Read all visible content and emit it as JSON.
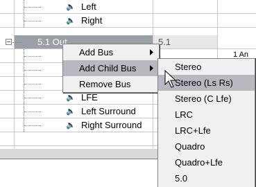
{
  "tree": {
    "expander_symbol": "−",
    "rows": [
      {
        "label": "Left",
        "icon": "speaker-icon"
      },
      {
        "label": "Right",
        "icon": "speaker-icon"
      },
      {
        "label": "5.1 Out",
        "config": "5.1"
      },
      {
        "label": "LFE",
        "icon": "speaker-icon"
      },
      {
        "label": "Left Surround",
        "icon": "speaker-icon"
      },
      {
        "label": "Right Surround",
        "icon": "speaker-icon"
      }
    ],
    "partial_right_text": "1 An"
  },
  "context_menu": {
    "items": [
      {
        "label": "Add Bus",
        "has_submenu": true
      },
      {
        "label": "Add Child Bus",
        "has_submenu": true,
        "selected": true
      },
      {
        "label": "Remove Bus",
        "has_submenu": false
      }
    ]
  },
  "submenu": {
    "items": [
      {
        "label": "Stereo"
      },
      {
        "label": "Stereo (Ls Rs)",
        "selected": true
      },
      {
        "label": "Stereo (C Lfe)"
      },
      {
        "label": "LRC"
      },
      {
        "label": "LRC+Lfe"
      },
      {
        "label": "Quadro"
      },
      {
        "label": "Quadro+Lfe"
      },
      {
        "label": "5.0"
      }
    ]
  },
  "colors": {
    "selection": "#b8b8c0",
    "bus_row_highlight": "#9aa0a6",
    "menu_bg": "#f0f0f0"
  }
}
